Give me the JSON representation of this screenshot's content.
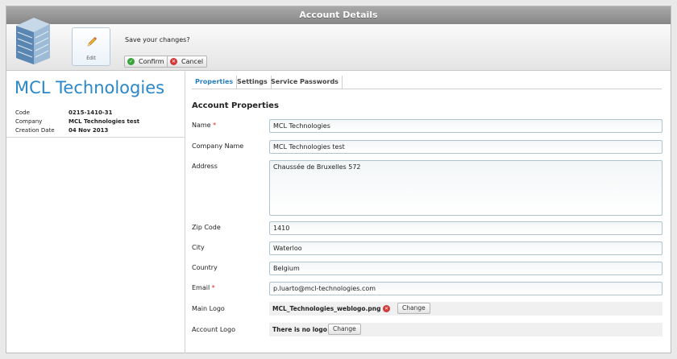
{
  "window": {
    "title": "Account Details"
  },
  "toolbar": {
    "edit_label": "Edit",
    "save_prompt": "Save your changes?",
    "confirm_label": "Confirm",
    "cancel_label": "Cancel",
    "icons": {
      "building": "building-icon",
      "edit": "pencil-icon",
      "confirm": "check-icon",
      "cancel": "close-icon"
    }
  },
  "summary": {
    "company_name": "MCL Technologies",
    "rows": [
      {
        "key": "Code",
        "value": "0215-1410-31"
      },
      {
        "key": "Company",
        "value": "MCL Technologies test"
      },
      {
        "key": "Creation Date",
        "value": "04 Nov 2013"
      }
    ]
  },
  "tabs": [
    "Properties",
    "Settings",
    "Service Passwords"
  ],
  "form": {
    "section_title": "Account Properties",
    "name": {
      "label": "Name",
      "required_mark": "*",
      "value": "MCL Technologies"
    },
    "company_name": {
      "label": "Company Name",
      "value": "MCL Technologies test"
    },
    "address": {
      "label": "Address",
      "value": "Chaussée de Bruxelles 572"
    },
    "zip": {
      "label": "Zip Code",
      "value": "1410"
    },
    "city": {
      "label": "City",
      "value": "Waterloo"
    },
    "country": {
      "label": "Country",
      "value": "Belgium"
    },
    "email": {
      "label": "Email",
      "required_mark": "*",
      "value": "p.luarto@mcl-technologies.com"
    },
    "main_logo": {
      "label": "Main Logo",
      "file": "MCL_Technologies_weblogo.png",
      "change_label": "Change"
    },
    "account_logo": {
      "label": "Account Logo",
      "file": "There is no logo",
      "change_label": "Change"
    }
  },
  "colors": {
    "accent": "#2a87c8",
    "confirm": "#3aa43a",
    "cancel": "#d23a3a"
  }
}
